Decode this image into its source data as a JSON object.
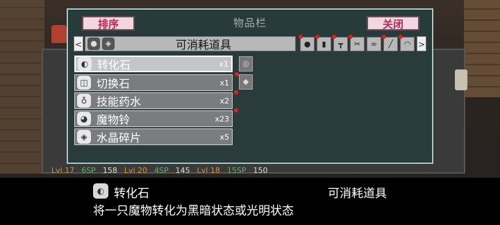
{
  "window": {
    "title": "物品栏",
    "sort_label": "排序",
    "close_label": "关闭"
  },
  "category_bar": {
    "left_arrow": "<",
    "right_arrow": ">",
    "current_category": "可消耗道具",
    "icons": [
      "potion-bag-icon",
      "jar-icon",
      "hammer-icon",
      "scroll-icon",
      "whistle-icon",
      "brush-icon",
      "hat-icon"
    ]
  },
  "items": [
    {
      "name": "转化石",
      "qty": "x1",
      "selected": true
    },
    {
      "name": "切换石",
      "qty": "x1",
      "selected": false
    },
    {
      "name": "技能药水",
      "qty": "x2",
      "selected": false
    },
    {
      "name": "魔物铃",
      "qty": "x23",
      "selected": false
    },
    {
      "name": "水晶碎片",
      "qty": "x5",
      "selected": false
    }
  ],
  "background_stats": [
    {
      "lvl": "Lvl 17",
      "sp": "6SP",
      "value": "158"
    },
    {
      "lvl": "Lvl 20",
      "sp": "4SP",
      "value": "145"
    },
    {
      "lvl": "Lvl 18",
      "sp": "15SP",
      "value": "150"
    }
  ],
  "info_bar": {
    "selected_name": "转化石",
    "selected_category": "可消耗道具",
    "description": "将一只魔物转化为黑暗状态或光明状态"
  },
  "colors": {
    "window_border": "#a9c8c6",
    "button_bg": "#f3d6df",
    "button_text": "#b52a56",
    "notification_dot": "#e02020"
  }
}
